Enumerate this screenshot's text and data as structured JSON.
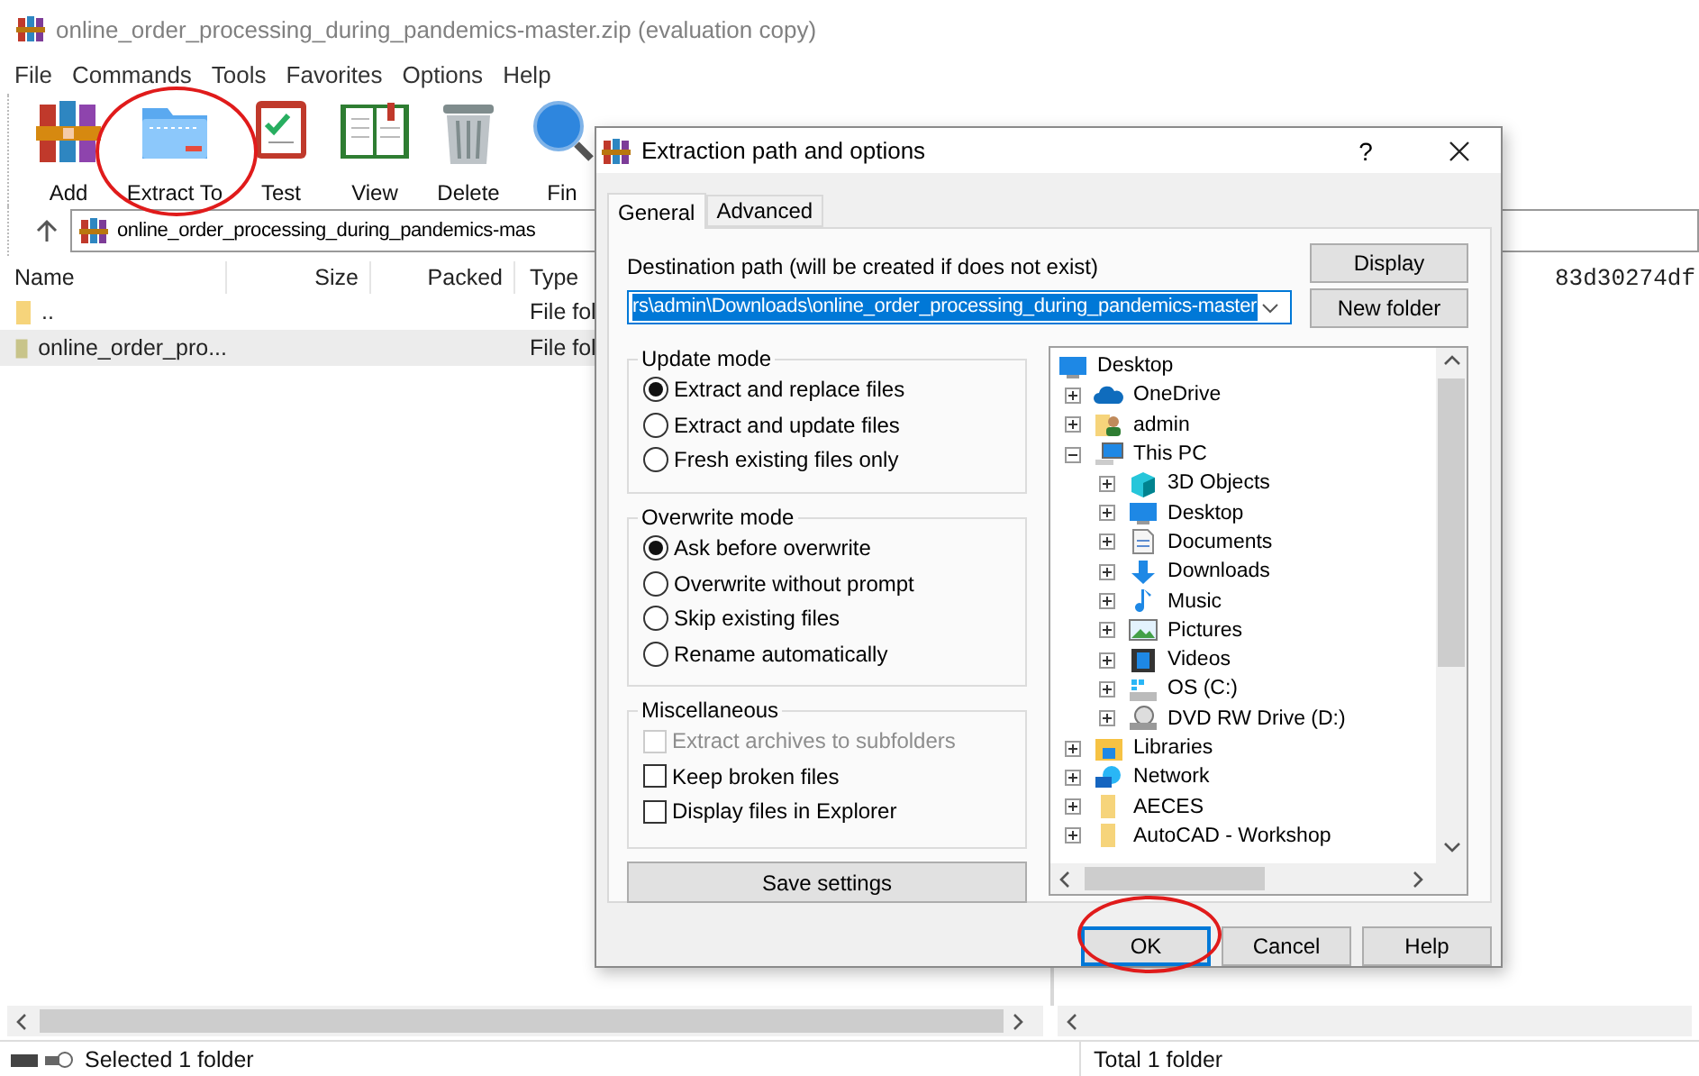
{
  "window": {
    "title": "online_order_processing_during_pandemics-master.zip (evaluation copy)"
  },
  "menu": [
    "File",
    "Commands",
    "Tools",
    "Favorites",
    "Options",
    "Help"
  ],
  "toolbar": [
    {
      "label": "Add",
      "kind": "add"
    },
    {
      "label": "Extract To",
      "kind": "extract"
    },
    {
      "label": "Test",
      "kind": "test"
    },
    {
      "label": "View",
      "kind": "view"
    },
    {
      "label": "Delete",
      "kind": "delete"
    },
    {
      "label": "Fin",
      "kind": "find"
    }
  ],
  "address": {
    "value": "online_order_processing_during_pandemics-mas"
  },
  "file_list": {
    "columns": [
      "Name",
      "Size",
      "Packed",
      "Type"
    ],
    "rows": [
      {
        "name": "..",
        "type": "File fol",
        "selected": false
      },
      {
        "name": "online_order_pro...",
        "type": "File fol",
        "selected": true
      }
    ]
  },
  "comment": {
    "text": "83d30274df"
  },
  "status_bar": {
    "left": "Selected 1 folder",
    "right": "Total 1 folder"
  },
  "dialog": {
    "title": "Extraction path and options",
    "help": "?",
    "tabs": [
      {
        "label": "General",
        "selected": true
      },
      {
        "label": "Advanced",
        "selected": false
      }
    ],
    "destination": {
      "label": "Destination path (will be created if does not exist)",
      "value": "rs\\admin\\Downloads\\online_order_processing_during_pandemics-master"
    },
    "side_buttons": [
      "Display",
      "New folder"
    ],
    "update_mode": {
      "title": "Update mode",
      "options": [
        {
          "label": "Extract and replace files",
          "selected": true
        },
        {
          "label": "Extract and update files",
          "selected": false
        },
        {
          "label": "Fresh existing files only",
          "selected": false
        }
      ]
    },
    "overwrite_mode": {
      "title": "Overwrite mode",
      "options": [
        {
          "label": "Ask before overwrite",
          "selected": true
        },
        {
          "label": "Overwrite without prompt",
          "selected": false
        },
        {
          "label": "Skip existing files",
          "selected": false
        },
        {
          "label": "Rename automatically",
          "selected": false
        }
      ]
    },
    "miscellaneous": {
      "title": "Miscellaneous",
      "options": [
        {
          "label": "Extract archives to subfolders",
          "checked": false,
          "disabled": true
        },
        {
          "label": "Keep broken files",
          "checked": false,
          "disabled": false
        },
        {
          "label": "Display files in Explorer",
          "checked": false,
          "disabled": false
        }
      ]
    },
    "save_button": "Save settings",
    "tree": [
      {
        "label": "Desktop",
        "kind": "desktop",
        "children": [
          {
            "label": "OneDrive",
            "kind": "cloud",
            "expanded": false
          },
          {
            "label": "admin",
            "kind": "user",
            "expanded": false
          },
          {
            "label": "This PC",
            "kind": "computer",
            "expanded": true,
            "children": [
              {
                "label": "3D Objects",
                "kind": "cube",
                "expanded": false
              },
              {
                "label": "Desktop",
                "kind": "desktop",
                "expanded": false
              },
              {
                "label": "Documents",
                "kind": "document",
                "expanded": false
              },
              {
                "label": "Downloads",
                "kind": "download",
                "expanded": false
              },
              {
                "label": "Music",
                "kind": "music",
                "expanded": false
              },
              {
                "label": "Pictures",
                "kind": "picture",
                "expanded": false
              },
              {
                "label": "Videos",
                "kind": "video",
                "expanded": false
              },
              {
                "label": "OS (C:)",
                "kind": "disk",
                "expanded": false
              },
              {
                "label": "DVD RW Drive (D:)",
                "kind": "dvd",
                "expanded": false
              }
            ]
          },
          {
            "label": "Libraries",
            "kind": "library",
            "expanded": false
          },
          {
            "label": "Network",
            "kind": "network",
            "expanded": false
          },
          {
            "label": "AECES",
            "kind": "folder",
            "expanded": false
          },
          {
            "label": "AutoCAD - Workshop",
            "kind": "folder",
            "expanded": false
          }
        ]
      }
    ],
    "buttons": [
      {
        "label": "OK",
        "default": true
      },
      {
        "label": "Cancel",
        "default": false
      },
      {
        "label": "Help",
        "default": false
      }
    ]
  }
}
